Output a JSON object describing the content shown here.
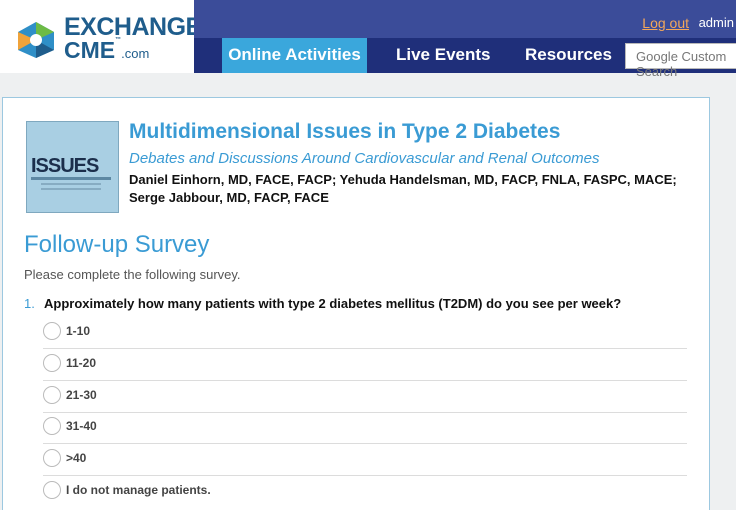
{
  "header": {
    "logo_line1": "EXCHANGE",
    "logo_line2": "CME",
    "logo_tm": "™",
    "logo_domain": ".com",
    "logout_label": "Log out",
    "user": "admin",
    "nav": [
      "Online Activities",
      "Live Events",
      "Resources"
    ],
    "search_placeholder": "Google Custom Search",
    "colors": {
      "topbar": "#3b4c99",
      "navbar": "#1f2f7a",
      "active": "#3aa7dc",
      "logout": "#f3a75a"
    }
  },
  "course": {
    "cover_word": "ISSUES",
    "title": "Multidimensional Issues in Type 2 Diabetes",
    "subtitle": "Debates and Discussions Around Cardiovascular and Renal Outcomes",
    "faculty": "Daniel Einhorn, MD, FACE, FACP; Yehuda Handelsman, MD, FACP, FNLA, FASPC, MACE; Serge Jabbour, MD, FACP, FACE"
  },
  "survey": {
    "title": "Follow-up Survey",
    "instructions": "Please complete the following survey.",
    "question_number": "1.",
    "question": "Approximately how many patients with type 2 diabetes mellitus (T2DM) do you see per week?",
    "options": [
      "1-10",
      "11-20",
      "21-30",
      "31-40",
      ">40",
      "I do not manage patients."
    ]
  }
}
